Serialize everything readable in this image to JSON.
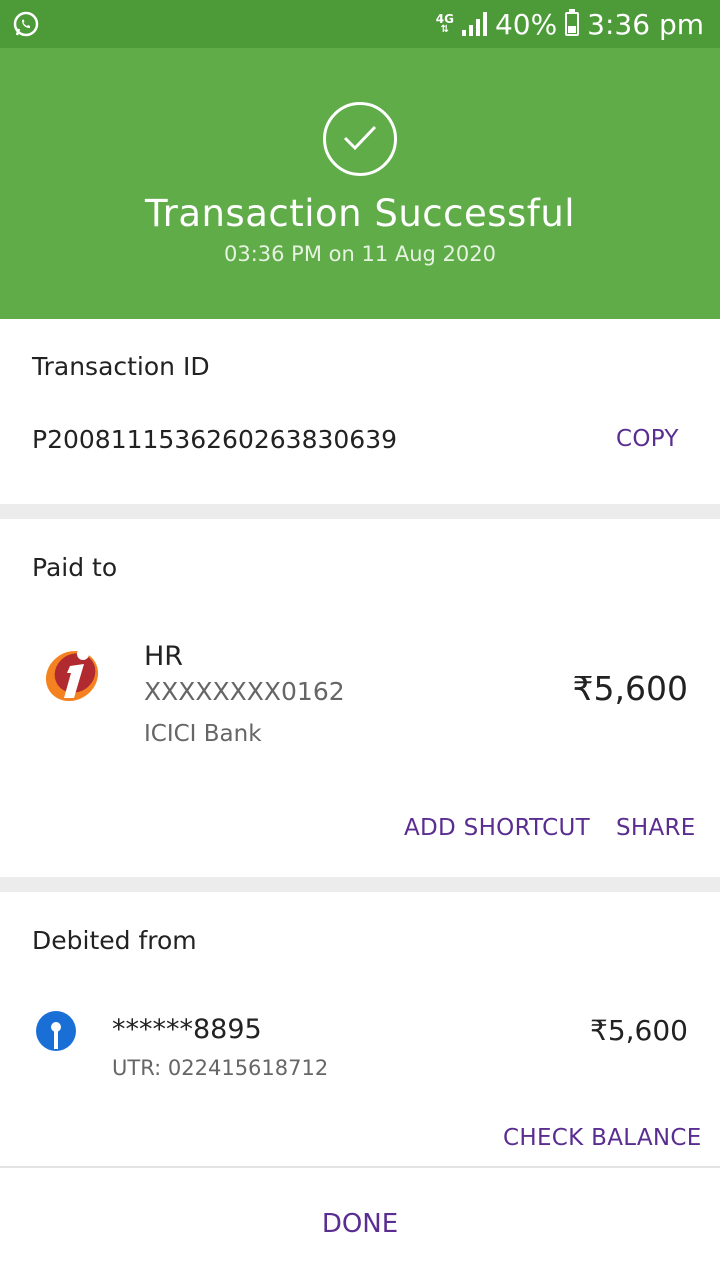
{
  "status_bar": {
    "network": "4G",
    "battery": "40%",
    "battery_level": 0.4,
    "time": "3:36 pm",
    "icons": [
      "whatsapp-icon",
      "signal-icon",
      "battery-icon"
    ]
  },
  "header": {
    "title": "Transaction Successful",
    "subtitle": "03:36 PM on 11 Aug 2020"
  },
  "transaction": {
    "label": "Transaction ID",
    "id": "P2008111536260263830639",
    "copy_label": "COPY"
  },
  "paid_to": {
    "label": "Paid to",
    "name": "HR",
    "account": "XXXXXXXX0162",
    "bank": "ICICI Bank",
    "amount": "₹5,600",
    "add_shortcut_label": "ADD SHORTCUT",
    "share_label": "SHARE"
  },
  "debited_from": {
    "label": "Debited from",
    "account": "******8895",
    "utr": "UTR: 022415618712",
    "amount": "₹5,600",
    "check_balance_label": "CHECK BALANCE"
  },
  "footer": {
    "done_label": "DONE"
  },
  "colors": {
    "status_bar": "#4c9a38",
    "header": "#5fac48",
    "accent": "#5a2d91",
    "divider": "#ececec"
  }
}
